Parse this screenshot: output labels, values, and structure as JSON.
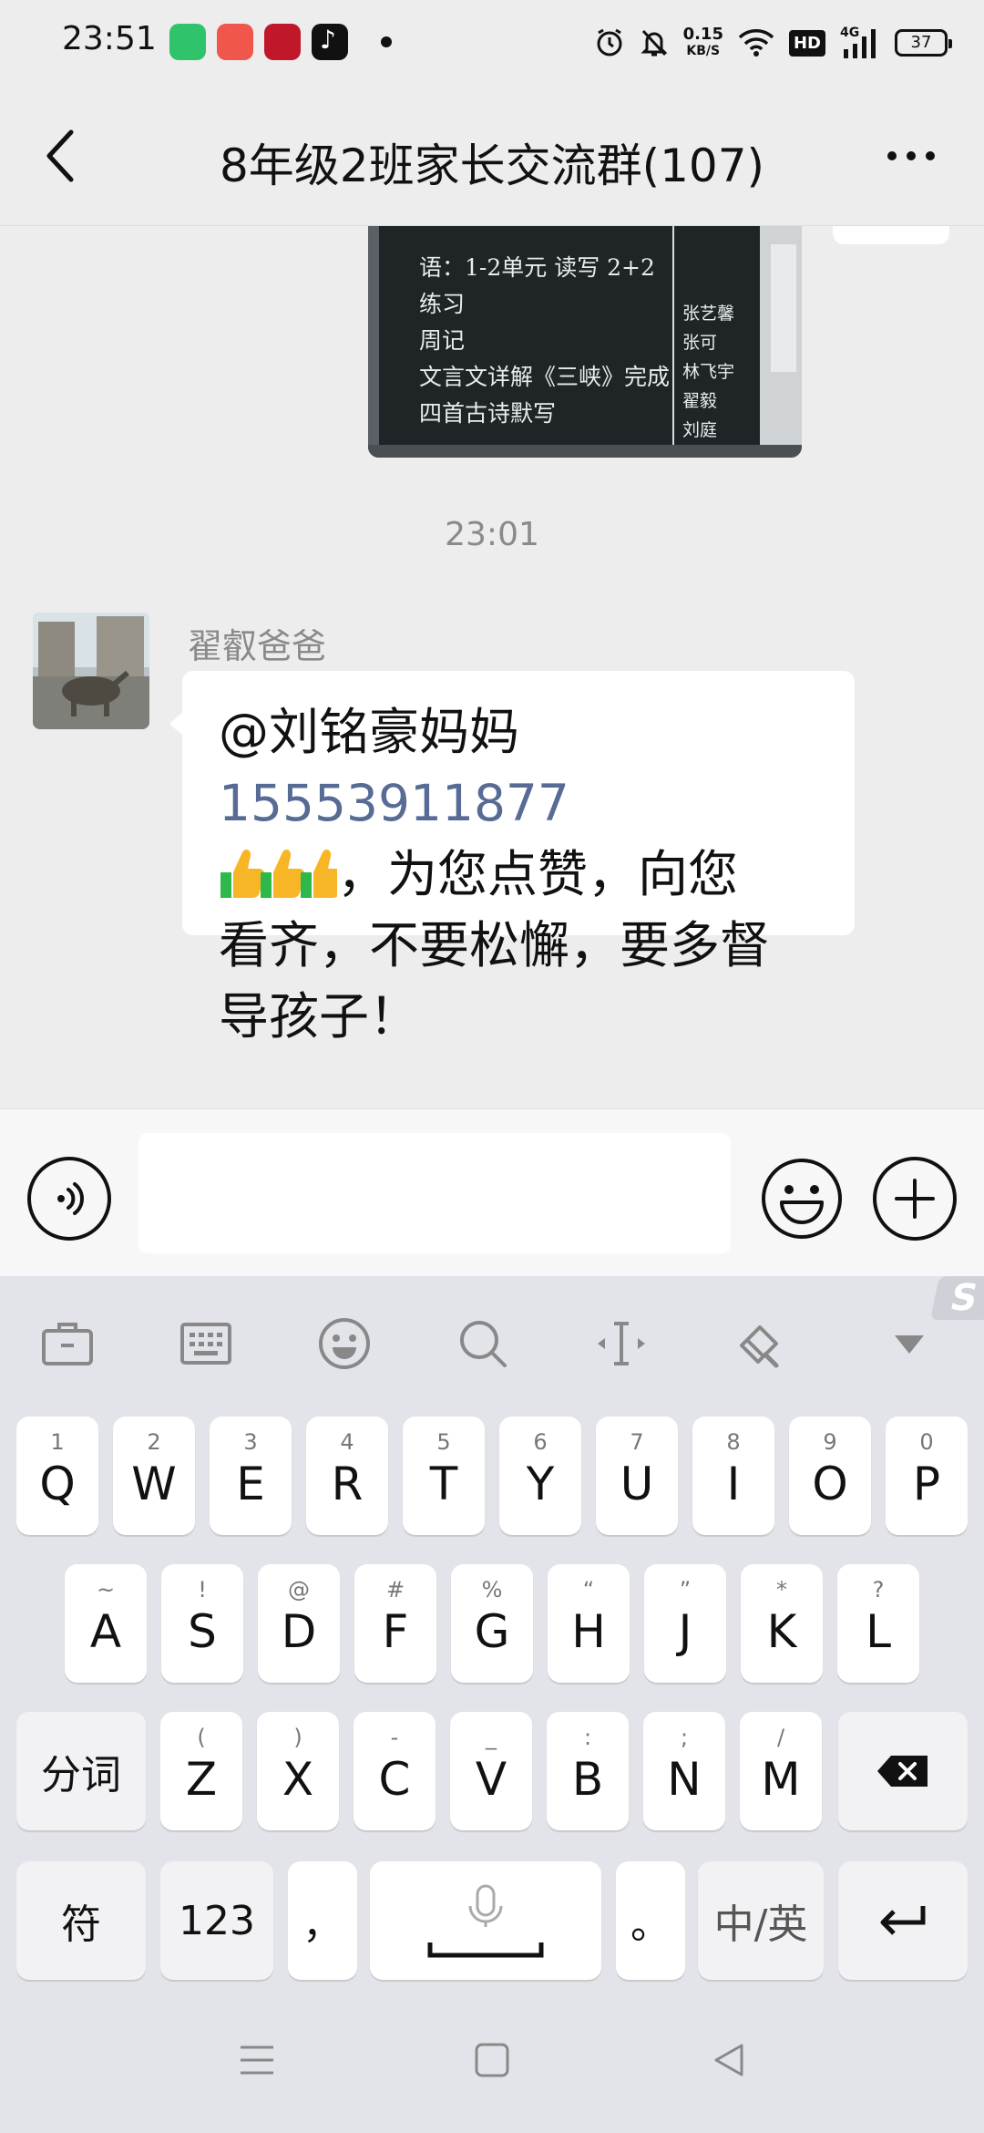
{
  "status_bar": {
    "time": "23:51",
    "net_speed_value": "0.15",
    "net_speed_unit": "KB/S",
    "hd_badge": "HD",
    "network": "4G",
    "battery": "37",
    "app_icons": [
      "wechat-work-icon",
      "music-icon",
      "study-app-icon",
      "tiktok-icon"
    ]
  },
  "header": {
    "title": "8年级2班家长交流群(107)",
    "back_icon": "chevron-left-icon",
    "more_icon": "ellipsis-icon"
  },
  "chat": {
    "time_divider": "23:01",
    "image_message": {
      "blackboard_lines": [
        "语：1-2单元 读写 2+2",
        "练习",
        "周记",
        "文言文详解《三峡》完成",
        "四首古诗默写"
      ],
      "side_names": [
        "张艺馨",
        "张可",
        "林飞宇",
        "翟毅",
        "刘庭"
      ]
    },
    "message": {
      "sender": "翟叡爸爸",
      "mention": "@刘铭豪妈妈",
      "phone": "15553911877",
      "line3_text": "，为您点赞，向您",
      "line4": "看齐，不要松懈，要多督",
      "line5": "导孩子！"
    }
  },
  "input": {
    "value": "",
    "voice_icon": "voice-icon",
    "emoji_icon": "emoji-icon",
    "plus_icon": "plus-icon"
  },
  "keyboard": {
    "toolbar": [
      "briefcase-icon",
      "keyboard-icon",
      "emoji-icon",
      "search-icon",
      "cursor-icon",
      "paint-icon",
      "collapse-icon"
    ],
    "logo": "S",
    "row1": [
      {
        "hint": "1",
        "key": "Q"
      },
      {
        "hint": "2",
        "key": "W"
      },
      {
        "hint": "3",
        "key": "E"
      },
      {
        "hint": "4",
        "key": "R"
      },
      {
        "hint": "5",
        "key": "T"
      },
      {
        "hint": "6",
        "key": "Y"
      },
      {
        "hint": "7",
        "key": "U"
      },
      {
        "hint": "8",
        "key": "I"
      },
      {
        "hint": "9",
        "key": "O"
      },
      {
        "hint": "0",
        "key": "P"
      }
    ],
    "row2": [
      {
        "hint": "~",
        "key": "A"
      },
      {
        "hint": "!",
        "key": "S"
      },
      {
        "hint": "@",
        "key": "D"
      },
      {
        "hint": "#",
        "key": "F"
      },
      {
        "hint": "%",
        "key": "G"
      },
      {
        "hint": "“",
        "key": "H"
      },
      {
        "hint": "”",
        "key": "J"
      },
      {
        "hint": "*",
        "key": "K"
      },
      {
        "hint": "?",
        "key": "L"
      }
    ],
    "row3": [
      {
        "hint": "(",
        "key": "Z"
      },
      {
        "hint": ")",
        "key": "X"
      },
      {
        "hint": "-",
        "key": "C"
      },
      {
        "hint": "_",
        "key": "V"
      },
      {
        "hint": ":",
        "key": "B"
      },
      {
        "hint": ";",
        "key": "N"
      },
      {
        "hint": "/",
        "key": "M"
      }
    ],
    "segment_label": "分词",
    "symbol_label": "符",
    "num_label": "123",
    "comma": "，",
    "period": "。",
    "lang_label": "中/英"
  }
}
